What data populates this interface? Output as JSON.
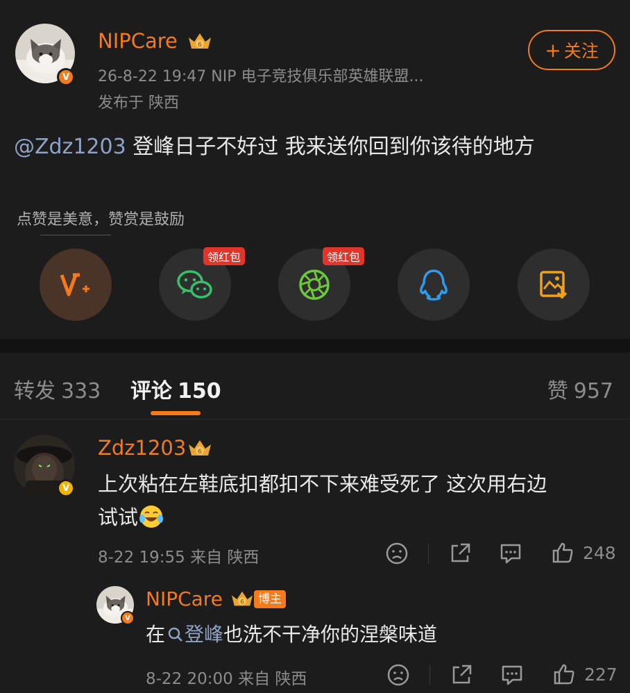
{
  "post": {
    "author": "NIPCare",
    "meta_line": "26-8-22 19:47  NIP 电子竞技俱乐部英雄联盟...",
    "location_line": "发布于 陕西",
    "follow_label": "关注",
    "mention": "@Zdz1203",
    "text": " 登峰日子不好过 我来送你回到你该待的地方",
    "reward_tip": "点赞是美意，赞赏是鼓励",
    "share": {
      "wechat_badge": "领红包",
      "moments_badge": "领红包"
    }
  },
  "tabs": {
    "repost_label": "转发",
    "repost_count": "333",
    "comment_label": "评论",
    "comment_count": "150",
    "like_label": "赞",
    "like_count": "957"
  },
  "comments": [
    {
      "author": "Zdz1203",
      "text_line1": "上次粘在左鞋底扣都扣不下来难受死了 这次用右边",
      "text_line2": "试试",
      "meta": "8-22 19:55  来自 陕西",
      "likes": "248"
    }
  ],
  "reply": {
    "author": "NIPCare",
    "tag": "博主",
    "prefix": "在",
    "topic": "登峰",
    "suffix": "也洗不干净你的涅槃味道",
    "meta": "8-22 20:00  来自 陕西",
    "likes": "227"
  },
  "colors": {
    "accent": "#f37b1d",
    "background": "#1c1c1c",
    "link": "#8fa3c8",
    "red_badge": "#e0352b"
  }
}
